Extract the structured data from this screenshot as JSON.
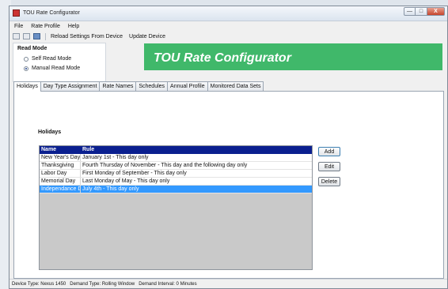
{
  "window": {
    "title": "TOU Rate Configurator"
  },
  "caption": {
    "minimize": "—",
    "maximize": "□",
    "close": "X"
  },
  "menu": [
    "File",
    "Rate Profile",
    "Help"
  ],
  "toolbar": {
    "reload": "Reload Settings From Device",
    "update": "Update Device"
  },
  "read_mode": {
    "title": "Read Mode",
    "options": [
      {
        "label": "Self Read Mode",
        "selected": false
      },
      {
        "label": "Manual Read Mode",
        "selected": true
      }
    ]
  },
  "banner": {
    "title": "TOU Rate Configurator",
    "color": "#40b86a"
  },
  "tabs": [
    "Holidays",
    "Day Type Assignment",
    "Rate Names",
    "Schedules",
    "Annual Profile",
    "Monitored Data Sets"
  ],
  "holidays": {
    "section_title": "Holidays",
    "columns": {
      "name": "Name",
      "rule": "Rule"
    },
    "rows": [
      {
        "name": "New Year's Day",
        "rule": "January 1st - This day only"
      },
      {
        "name": "Thanksgiving",
        "rule": "Fourth Thursday of November - This day and the following day only"
      },
      {
        "name": "Labor Day",
        "rule": "First Monday of September - This day only"
      },
      {
        "name": "Memorial Day",
        "rule": "Last Monday of May - This day only"
      },
      {
        "name": "Independance Day",
        "rule": "July 4th - This day only"
      }
    ],
    "selected_row": 4,
    "buttons": {
      "add": "Add",
      "edit": "Edit",
      "delete": "Delete"
    }
  },
  "status": {
    "device_type": "Device Type:  Nexus 1450",
    "demand_type": "Demand Type:  Rolling Window",
    "demand_interval": "Demand Interval:  0 Minutes"
  }
}
